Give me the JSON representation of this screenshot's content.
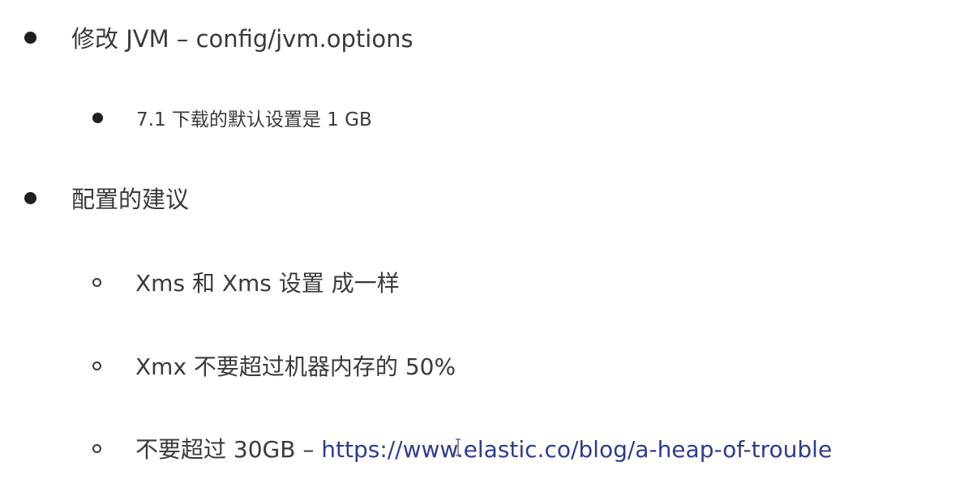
{
  "items": [
    {
      "text": "修改 JVM – config/jvm.options"
    },
    {
      "text": "7.1 下载的默认设置是 1 GB"
    },
    {
      "text": "配置的建议"
    },
    {
      "text": "Xms 和 Xms 设置 成一样"
    },
    {
      "text": "Xmx 不要超过机器内存的 50%"
    },
    {
      "text": "不要超过 30GB – ",
      "link": "https://www.elastic.co/blog/a-heap-of-trouble"
    }
  ],
  "colors": {
    "text": "#3a3a3a",
    "bullet": "#1f1f1f",
    "link": "#2f3c8f",
    "background": "#ffffff"
  }
}
